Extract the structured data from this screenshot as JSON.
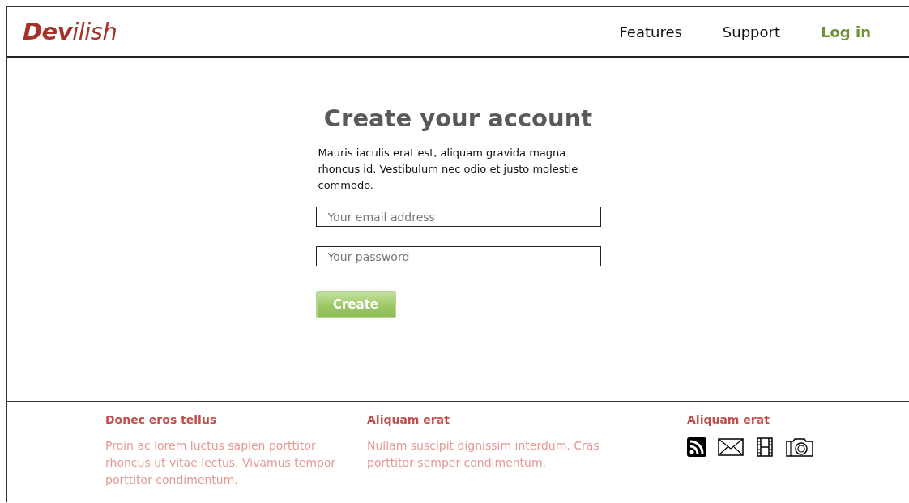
{
  "header": {
    "logo": "**Dev**ilish",
    "nav": [
      {
        "label": "Features",
        "kind": "link"
      },
      {
        "label": "Support",
        "kind": "link"
      },
      {
        "label": "Log in",
        "kind": "login"
      }
    ]
  },
  "signup": {
    "title": "Create your account",
    "intro": "Mauris iaculis erat est, aliquam gravida magna rhoncus id. Vestibulum nec odio et justo molestie commodo.",
    "fields": [
      {
        "placeholder": "Your email address"
      },
      {
        "placeholder": "Your password"
      }
    ],
    "button": "Create"
  },
  "footer": {
    "columns": [
      {
        "heading": "Donec eros tellus",
        "text": "Proin ac lorem luctus sapien porttitor rhoncus ut vitae lectus. Vivamus tempor porttitor condimentum."
      },
      {
        "heading": "Aliquam erat",
        "text": "Nullam suscipit dignissim interdum. Cras porttitor semper condimentum."
      },
      {
        "heading": "Aliquam erat",
        "icons": [
          {
            "kind": "rss"
          },
          {
            "kind": "mail"
          },
          {
            "kind": "film"
          },
          {
            "kind": "camera"
          }
        ]
      }
    ]
  }
}
